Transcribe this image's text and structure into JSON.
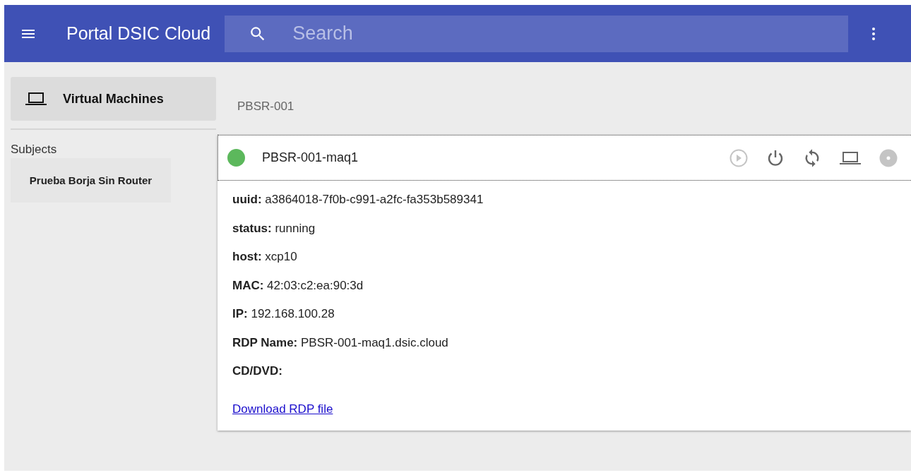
{
  "app_bar": {
    "title": "Portal DSIC Cloud",
    "search": {
      "placeholder": "Search"
    }
  },
  "sidebar": {
    "items": [
      {
        "label": "Virtual Machines",
        "selected": true
      }
    ],
    "section_title": "Subjects",
    "subjects": [
      {
        "label": "Prueba Borja Sin Router",
        "selected": false
      }
    ]
  },
  "main": {
    "group_title": "PBSR-001",
    "vm": {
      "name": "PBSR-001-maq1",
      "color": "#5cb85c",
      "actions": [
        {
          "kind": "start",
          "disabled": true
        },
        {
          "kind": "power",
          "disabled": false
        },
        {
          "kind": "restart",
          "disabled": false
        },
        {
          "kind": "console",
          "disabled": false
        },
        {
          "kind": "disc",
          "disabled": true
        }
      ],
      "details": [
        {
          "text": "**uuid:** a3864018-7f0b-c991-a2fc-fa353b589341"
        },
        {
          "text": "**status:** running"
        },
        {
          "text": "**host:** xcp10"
        },
        {
          "text": "**MAC:** 42:03:c2:ea:90:3d"
        },
        {
          "text": "**IP:** 192.168.100.28"
        },
        {
          "text": "**RDP Name:** PBSR-001-maq1.dsic.cloud"
        },
        {
          "text": "**CD/DVD:**"
        }
      ],
      "link": "Download RDP file"
    }
  }
}
